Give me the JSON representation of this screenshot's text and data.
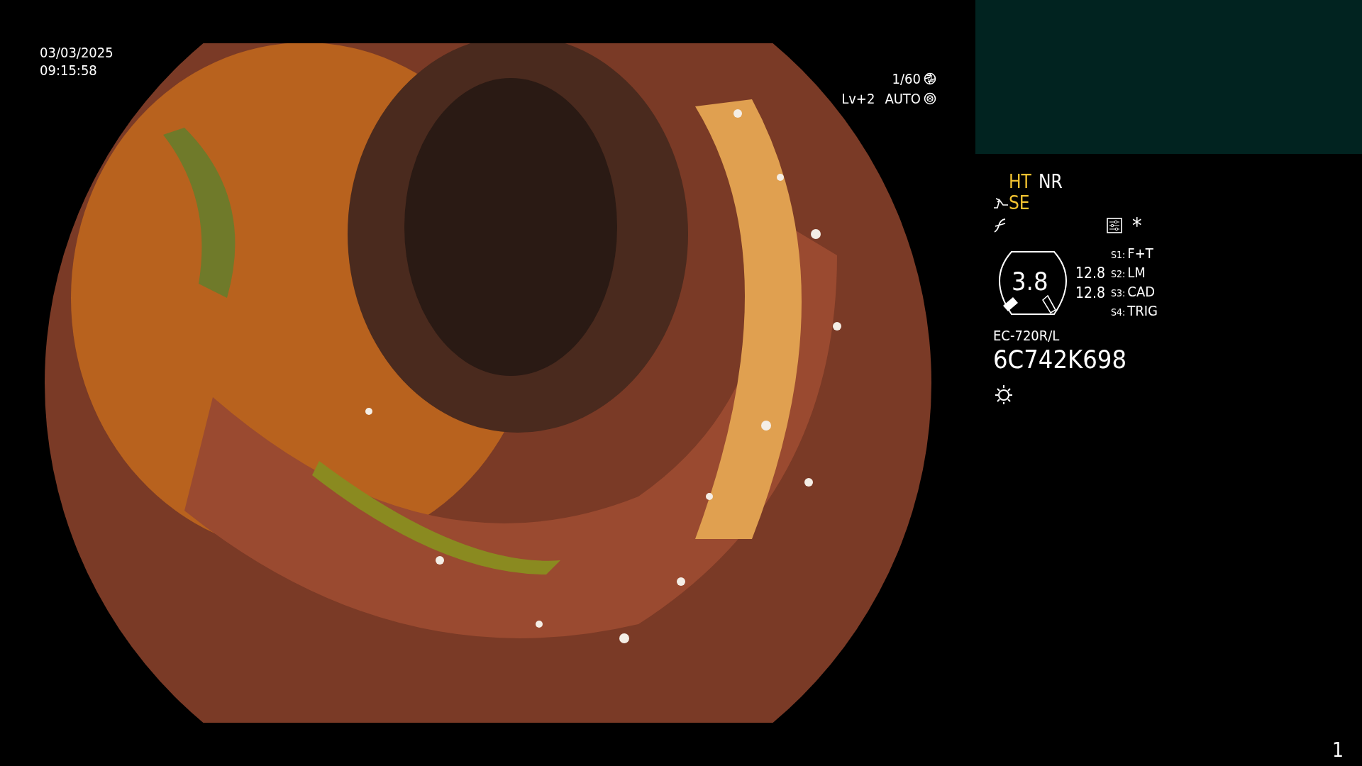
{
  "datetime": {
    "date": "03/03/2025",
    "time": "09:15:58"
  },
  "exposure": {
    "shutter": "1/60",
    "level": "Lv+2",
    "mode": "AUTO"
  },
  "status": {
    "modes": [
      {
        "label": "HT",
        "on": true
      },
      {
        "label": "NR",
        "on": false
      }
    ],
    "enhancement": {
      "label": "SE",
      "on": true
    }
  },
  "zoom": {
    "value": "3.8",
    "readings": [
      "12.8",
      "12.8"
    ]
  },
  "switches": [
    {
      "key": "S1:",
      "function": "F+T"
    },
    {
      "key": "S2:",
      "function": "LM"
    },
    {
      "key": "S3:",
      "function": "CAD"
    },
    {
      "key": "S4:",
      "function": "TRIG"
    }
  ],
  "scope": {
    "model": "EC-720R/L",
    "serial": "6C742K698"
  },
  "asterisk": "*",
  "page": "1"
}
